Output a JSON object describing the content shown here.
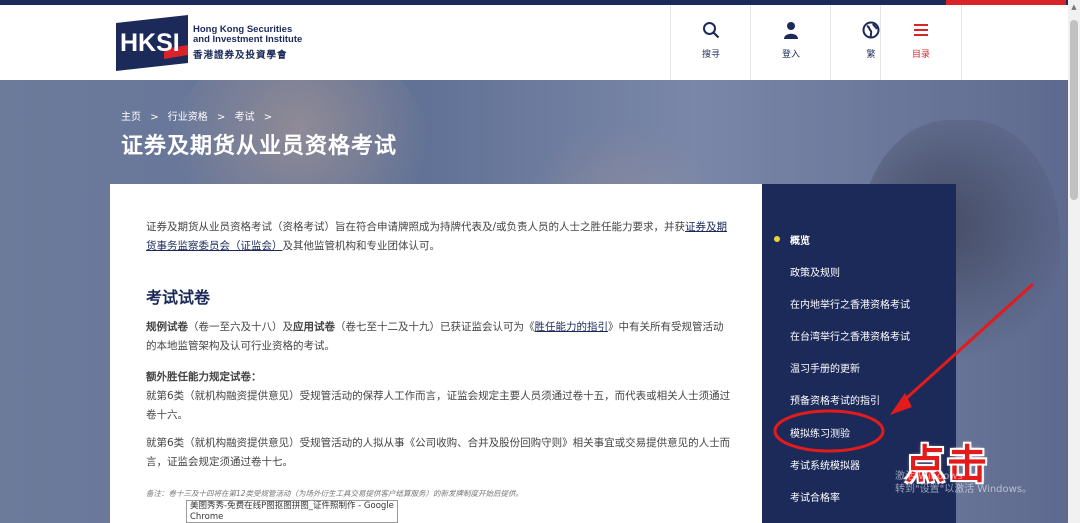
{
  "brand": {
    "logo_text": "HKSI",
    "name_en_line1": "Hong Kong Securities",
    "name_en_line2": "and Investment Institute",
    "name_zh": "香港證券及投資學會"
  },
  "nav": {
    "search": "搜寻",
    "login": "登入",
    "language": "繁",
    "menu": "目录"
  },
  "breadcrumb": {
    "home": "主页",
    "sep": ">",
    "level1": "行业资格",
    "level2": "考试"
  },
  "page_title": "证券及期货从业员资格考试",
  "content": {
    "intro_1": "证券及期货从业员资格考试（资格考试）旨在符合申请牌照成为持牌代表及/或负责人员的人士之胜任能力要求，并获",
    "intro_link": "证券及期货事务监察委员会（证监会）",
    "intro_2": "及其他监管机构和专业团体认可。",
    "section_title": "考试试卷",
    "p1_bold1": "规例试卷",
    "p1_text1": "（卷一至六及十八）及",
    "p1_bold2": "应用试卷",
    "p1_text2": "（卷七至十二及十九）已获证监会认可为《",
    "p1_link": "胜任能力的指引",
    "p1_text3": "》中有关所有受规管活动的本地监管架构及认可行业资格的考试。",
    "p2_bold": "额外胜任能力规定试卷：",
    "p2_text": "就第6类（就机构融资提供意见）受规管活动的保荐人工作而言，证监会规定主要人员须通过卷十五，而代表或相关人士须通过卷十六。",
    "p3_text": "就第6类（就机构融资提供意见）受规管活动的人拟从事《公司收购、合并及股份回购守则》相关事宜或交易提供意见的人士而言，证监会规定须通过卷十七。",
    "note": "备注：卷十三及十四将在第12类受规管活动（为场外衍生工具交易提供客户结算服务）的新发牌制度开始后提供。"
  },
  "sidebar": {
    "items": [
      "概览",
      "政策及规则",
      "在内地举行之香港资格考试",
      "在台湾举行之香港资格考试",
      "温习手册的更新",
      "预备资格考试的指引",
      "模拟练习测验",
      "考试系统模拟器",
      "考试合格率"
    ],
    "active_index": 0,
    "highlighted_index": 6
  },
  "annotation": {
    "click_label": "点击"
  },
  "watermark": {
    "line1": "激活 Windows",
    "line2": "转到\"设置\"以激活 Windows。"
  },
  "tooltip": {
    "text": "美图秀秀-免费在线P图抠图拼图_证件照制作 - Google Chrome"
  },
  "colors": {
    "navy": "#1c2a5a",
    "accent_red": "#d8232a",
    "active_dot": "#f2d23a",
    "annotation_red": "#e31b1b"
  }
}
